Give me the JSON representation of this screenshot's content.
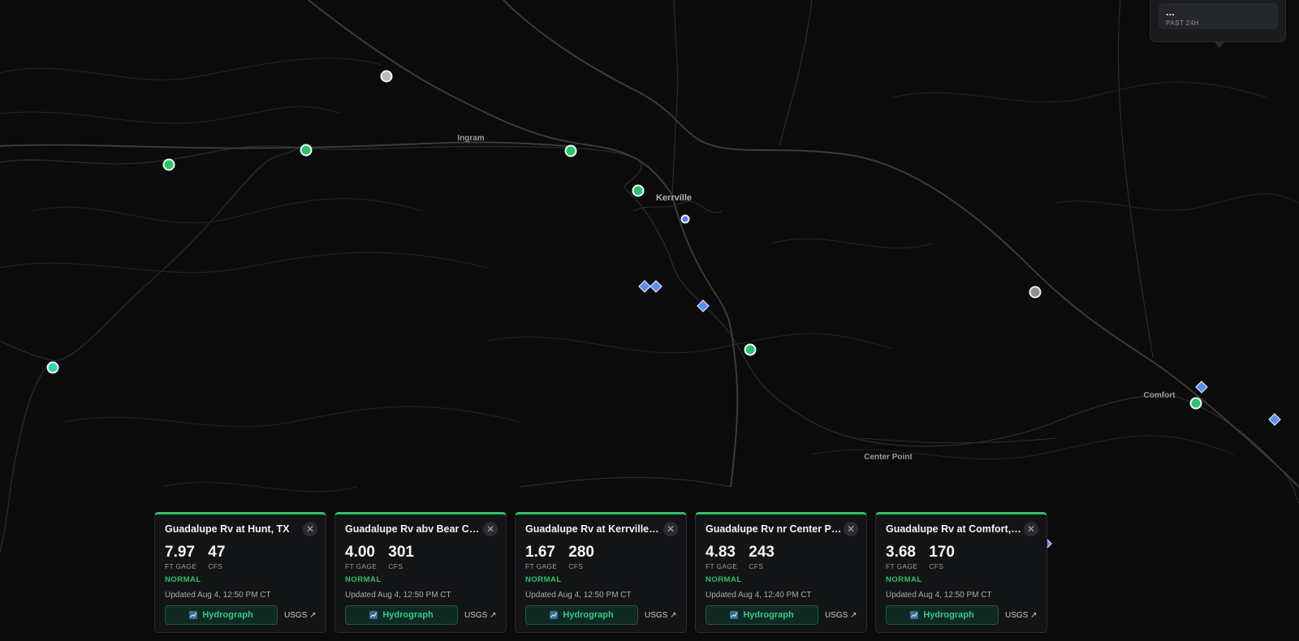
{
  "map": {
    "places": [
      {
        "name": "Ingram"
      },
      {
        "name": "Kerrville"
      },
      {
        "name": "Center Point"
      },
      {
        "name": "Comfort"
      }
    ],
    "colors": {
      "background": "#0b0b0c",
      "road": "#3b3b3e",
      "river": "#2c2c2f",
      "gauge_normal": "#2ec36a",
      "gauge_offline": "#b9b9b9",
      "gauge_teal": "#2fd4b0",
      "diamond": "#5b8fe8"
    }
  },
  "summary": {
    "value": "...",
    "period": "PAST 24H"
  },
  "cards": [
    {
      "title": "Guadalupe Rv at Hunt, TX",
      "gage": "7.97",
      "gage_unit": "FT GAGE",
      "flow": "47",
      "flow_unit": "CFS",
      "status": "NORMAL",
      "updated": "Updated Aug 4, 12:50 PM CT",
      "hydrograph_label": "Hydrograph",
      "source_label": "USGS ↗"
    },
    {
      "title": "Guadalupe Rv abv Bear Creek",
      "gage": "4.00",
      "gage_unit": "FT GAGE",
      "flow": "301",
      "flow_unit": "CFS",
      "status": "NORMAL",
      "updated": "Updated Aug 4, 12:50 PM CT",
      "hydrograph_label": "Hydrograph",
      "source_label": "USGS ↗"
    },
    {
      "title": "Guadalupe Rv at Kerrville, TX",
      "gage": "1.67",
      "gage_unit": "FT GAGE",
      "flow": "280",
      "flow_unit": "CFS",
      "status": "NORMAL",
      "updated": "Updated Aug 4, 12:50 PM CT",
      "hydrograph_label": "Hydrograph",
      "source_label": "USGS ↗"
    },
    {
      "title": "Guadalupe Rv nr Center Point",
      "gage": "4.83",
      "gage_unit": "FT GAGE",
      "flow": "243",
      "flow_unit": "CFS",
      "status": "NORMAL",
      "updated": "Updated Aug 4, 12:40 PM CT",
      "hydrograph_label": "Hydrograph",
      "source_label": "USGS ↗"
    },
    {
      "title": "Guadalupe Rv at Comfort, TX",
      "gage": "3.68",
      "gage_unit": "FT GAGE",
      "flow": "170",
      "flow_unit": "CFS",
      "status": "NORMAL",
      "updated": "Updated Aug 4, 12:50 PM CT",
      "hydrograph_label": "Hydrograph",
      "source_label": "USGS ↗"
    }
  ],
  "icons": {
    "close": "close-icon",
    "hydrograph": "chart-icon"
  }
}
